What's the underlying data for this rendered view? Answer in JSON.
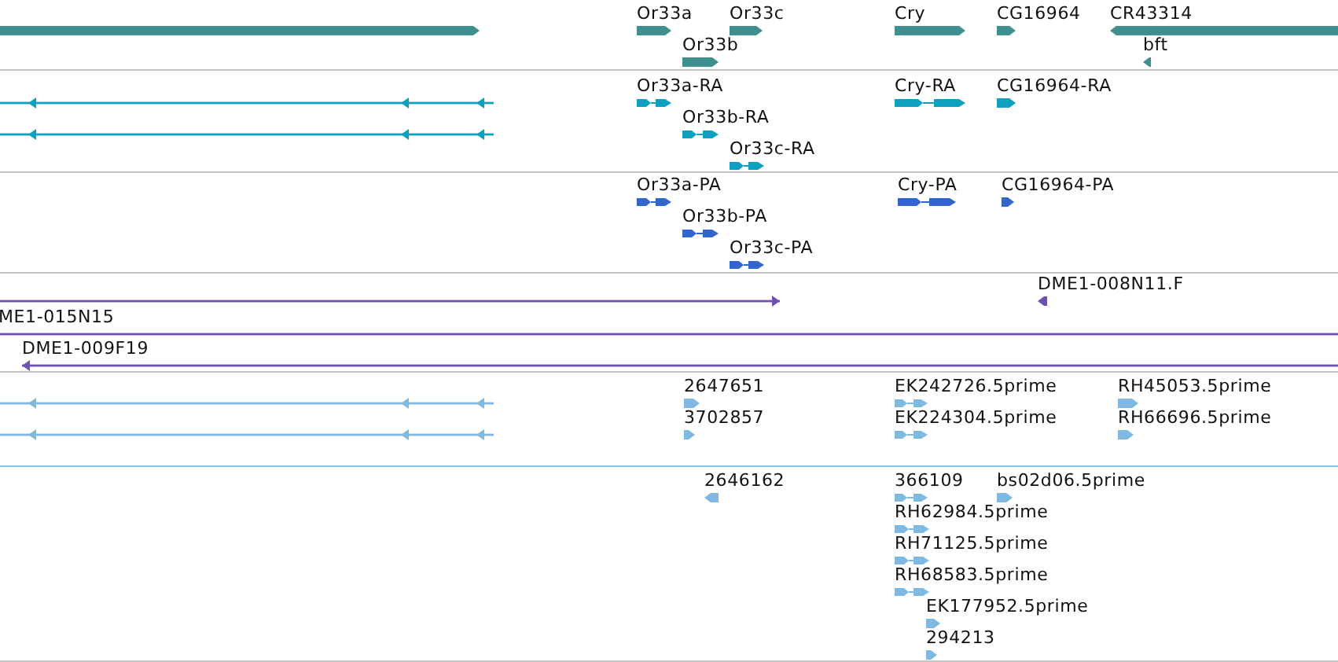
{
  "tracks": [
    {
      "color": "#3f8f8f",
      "features": [
        {
          "kind": "bar",
          "reverse": false
        },
        {
          "label": "Or33a",
          "kind": "bar",
          "reverse": false
        },
        {
          "label": "Or33c",
          "kind": "bar",
          "reverse": false
        },
        {
          "label": "Cry",
          "kind": "bar",
          "reverse": false
        },
        {
          "label": "CG16964",
          "kind": "bar",
          "reverse": false
        },
        {
          "label": "CR43314",
          "kind": "bar",
          "reverse": true
        },
        {
          "label": "Or33b",
          "kind": "bar",
          "reverse": false
        },
        {
          "label": "bft",
          "kind": "bar",
          "reverse": true
        }
      ]
    },
    {
      "color": "#0ea0c0",
      "features": [
        {
          "kind": "line",
          "reverse": true
        },
        {
          "label": "Or33a-RA",
          "kind": "split",
          "reverse": false
        },
        {
          "label": "Cry-RA",
          "kind": "split",
          "reverse": false
        },
        {
          "label": "CG16964-RA",
          "kind": "bar",
          "reverse": false
        },
        {
          "kind": "line",
          "reverse": true
        },
        {
          "label": "Or33b-RA",
          "kind": "split",
          "reverse": false
        },
        {
          "label": "Or33c-RA",
          "kind": "split",
          "reverse": false
        }
      ]
    },
    {
      "color": "#3366cc",
      "features": [
        {
          "label": "Or33a-PA",
          "kind": "split",
          "reverse": false
        },
        {
          "label": "Cry-PA",
          "kind": "split",
          "reverse": false
        },
        {
          "label": "CG16964-PA",
          "kind": "bar",
          "reverse": false
        },
        {
          "label": "Or33b-PA",
          "kind": "split",
          "reverse": false
        },
        {
          "label": "Or33c-PA",
          "kind": "split",
          "reverse": false
        }
      ]
    },
    {
      "color": "#7050b0",
      "features": [
        {
          "kind": "line",
          "reverse": false
        },
        {
          "label": "DME1-008N11.F",
          "kind": "bar",
          "reverse": true
        },
        {
          "label": "ME1-015N15",
          "kind": "line"
        },
        {
          "label": "DME1-009F19",
          "kind": "line",
          "reverse": true
        }
      ]
    },
    {
      "color": "#7fb8e0",
      "features": [
        {
          "kind": "line",
          "reverse": true
        },
        {
          "label": "2647651",
          "kind": "bar",
          "reverse": false
        },
        {
          "label": "EK242726.5prime",
          "kind": "split",
          "reverse": false
        },
        {
          "label": "RH45053.5prime",
          "kind": "bar",
          "reverse": false
        },
        {
          "kind": "line",
          "reverse": true
        },
        {
          "label": "3702857",
          "kind": "bar",
          "reverse": false
        },
        {
          "label": "EK224304.5prime",
          "kind": "split",
          "reverse": false
        },
        {
          "label": "RH66696.5prime",
          "kind": "bar",
          "reverse": false
        }
      ]
    },
    {
      "color": "#7fb8e0",
      "features": [
        {
          "label": "2646162",
          "kind": "bar",
          "reverse": true
        },
        {
          "label": "366109",
          "kind": "split",
          "reverse": false
        },
        {
          "label": "bs02d06.5prime",
          "kind": "bar",
          "reverse": false
        },
        {
          "label": "RH62984.5prime",
          "kind": "split",
          "reverse": false
        },
        {
          "label": "RH71125.5prime",
          "kind": "split",
          "reverse": false
        },
        {
          "label": "RH68583.5prime",
          "kind": "split",
          "reverse": false
        },
        {
          "label": "EK177952.5prime",
          "kind": "bar",
          "reverse": false
        },
        {
          "label": "294213",
          "kind": "bar",
          "reverse": false
        }
      ]
    }
  ]
}
